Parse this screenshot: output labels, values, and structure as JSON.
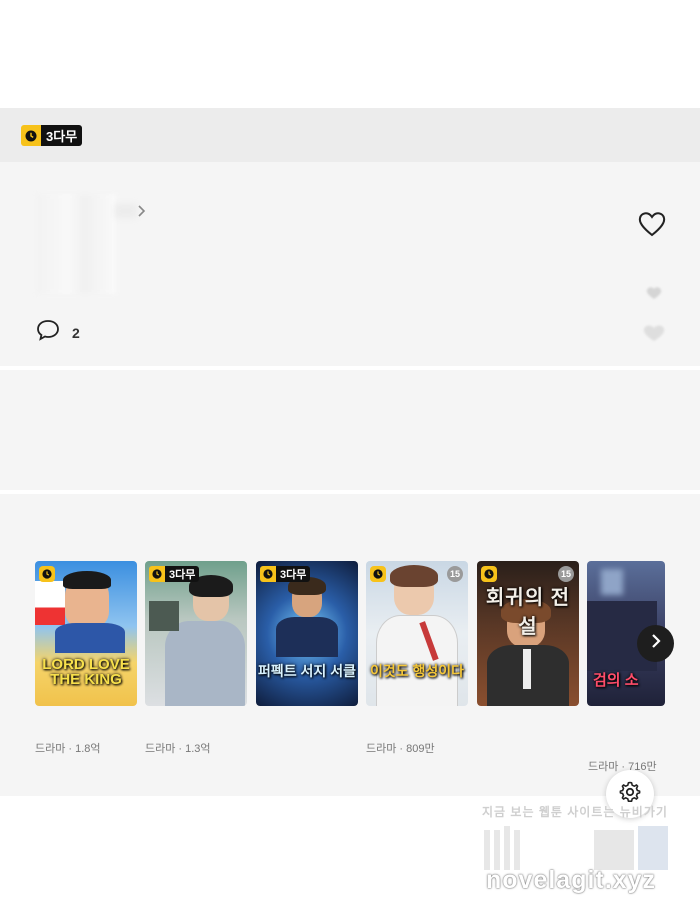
{
  "header": {
    "free_badge": "3다무"
  },
  "info": {
    "comment_count": "2"
  },
  "recommendations": {
    "items": [
      {
        "art_title": "LORD LOVE THE KING",
        "badge": "",
        "age": "",
        "meta": "드라마 · 1.8억"
      },
      {
        "art_title": "",
        "badge": "3다무",
        "age": "",
        "meta": "드라마 · 1.3억"
      },
      {
        "art_title": "퍼펙트 서지 서클",
        "badge": "3다무",
        "age": "",
        "meta": ""
      },
      {
        "art_title": "이것도 행성이다",
        "badge": "",
        "age": "15",
        "meta": "드라마 · 809만"
      },
      {
        "art_title": "회귀의 전설",
        "badge": "",
        "age": "15",
        "meta": ""
      },
      {
        "art_title": "검의 소",
        "badge": "",
        "age": "",
        "meta": "드라마 · 716만"
      }
    ]
  },
  "watermark": {
    "top_text": "지금 보는 웹툰 사이트는 뉴비가기",
    "url": "novelagit.xyz"
  },
  "colors": {
    "badge_yellow": "#f7c21a",
    "badge_black": "#111111",
    "panel_bg": "#f5f5f5",
    "bar_bg": "#ececec"
  }
}
